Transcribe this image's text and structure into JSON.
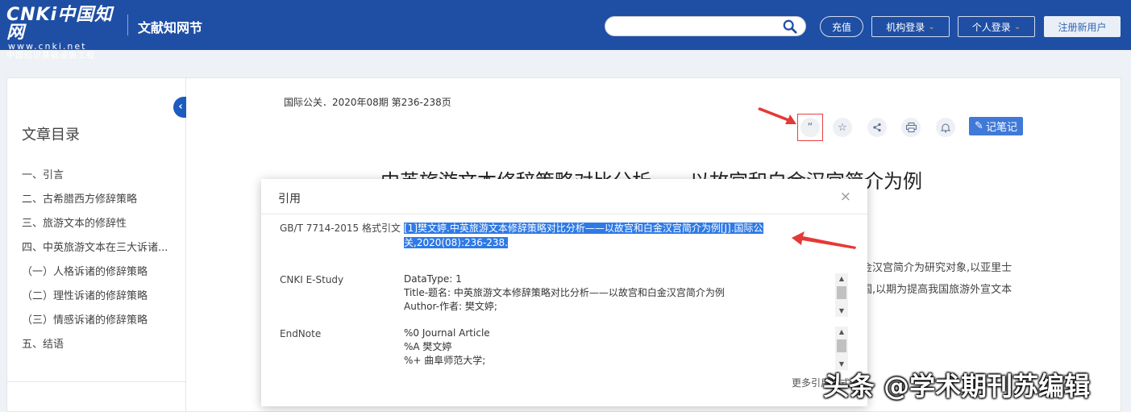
{
  "header": {
    "logo_main": "CNKi中国知网",
    "logo_url": "www.cnki.net",
    "logo_sub": "中国知识基础设施工程",
    "site_name": "文献知网节",
    "search_placeholder": "",
    "recharge": "充值",
    "institution_login": "机构登录",
    "personal_login": "个人登录",
    "register": "注册新用户"
  },
  "sidebar": {
    "collapse_icon": "chevron-left-icon",
    "title": "文章目录",
    "items": [
      "一、引言",
      "二、古希腊西方修辞策略",
      "三、旅游文本的修辞性",
      "四、中英旅游文本在三大诉诸...",
      "（一）人格诉诸的修辞策略",
      "（二）理性诉诸的修辞策略",
      "（三）情感诉诸的修辞策略",
      "五、结语"
    ]
  },
  "article": {
    "source": "国际公关．2020年08期  第236-238页",
    "title": "中英旅游文本修辞策略对比分析——以故宫和白金汉宫简介为例",
    "abstract_line1": "金汉宫简介为研究对象,以亚里士",
    "abstract_line2": "国,以期为提高我国旅游外宣文本",
    "tools": [
      "quote-icon",
      "star-icon",
      "share-icon",
      "print-icon",
      "bell-icon"
    ],
    "note_button": "记笔记"
  },
  "modal": {
    "title": "引用",
    "close": "×",
    "gbt_label": "GB/T 7714-2015 格式引文",
    "gbt_text": "[1]樊文婷.中英旅游文本修辞策略对比分析——以故宫和白金汉宫简介为例[J].国际公关,2020(08):236-238.",
    "estudy_label": "CNKI E-Study",
    "estudy_lines": [
      "DataType: 1",
      "Title-题名: 中英旅游文本修辞策略对比分析——以故宫和白金汉宫简介为例",
      "Author-作者: 樊文婷;"
    ],
    "endnote_label": "EndNote",
    "endnote_lines": [
      "%0 Journal Article",
      "%A 樊文婷",
      "%+ 曲阜师范大学;"
    ],
    "more": "更多引用格式"
  },
  "watermark": "头条 @学术期刊苏编辑",
  "colors": {
    "header_bg": "#1e4fa5",
    "highlight": "#2f7ae5",
    "arrow": "#e53935",
    "note_button": "#3f7ad8"
  }
}
